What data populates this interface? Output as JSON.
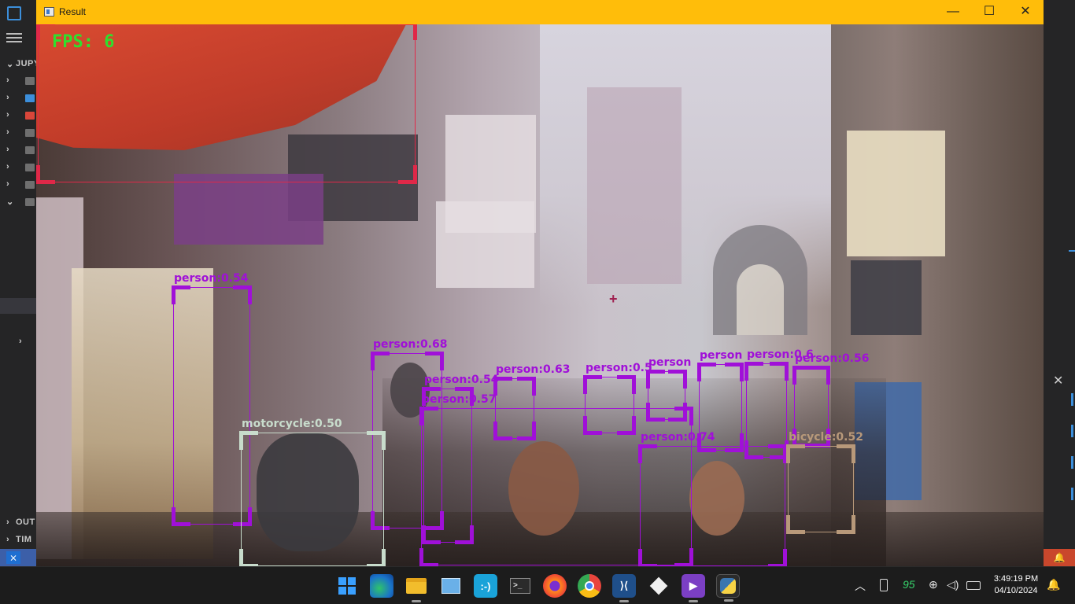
{
  "window": {
    "title": "Result",
    "minimize_glyph": "—",
    "maximize_glyph": "☐",
    "close_glyph": "✕"
  },
  "ide": {
    "explorer_label": "JUPY",
    "outline_label": "OUT",
    "timeline_label": "TIM",
    "rows": [
      {
        "chev": "›"
      },
      {
        "chev": "›"
      },
      {
        "chev": "›"
      },
      {
        "chev": "›"
      },
      {
        "chev": "›"
      },
      {
        "chev": "›"
      },
      {
        "chev": "›"
      },
      {
        "chev": "⌄"
      },
      {
        "chev": "⌄"
      },
      {
        "chev": "›"
      }
    ]
  },
  "overlay": {
    "fps": "FPS: 6",
    "cursor_glyph": "+"
  },
  "colors": {
    "person": "#a010d8",
    "motorcycle": "#c8dccc",
    "bicycle": "#b8997a",
    "unlabeled": "#e02848",
    "titlebar": "#ffbd0a"
  },
  "detections": [
    {
      "label": "",
      "color": "#e02848"
    },
    {
      "label": "person:0.54",
      "color": "#a010d8"
    },
    {
      "label": "person:0.68",
      "color": "#a010d8"
    },
    {
      "label": "person:0.54",
      "color": "#a010d8"
    },
    {
      "label": "person:0.57",
      "color": "#a010d8"
    },
    {
      "label": "person:0.63",
      "color": "#a010d8"
    },
    {
      "label": "person:0.5",
      "color": "#a010d8"
    },
    {
      "label": "person",
      "color": "#a010d8"
    },
    {
      "label": "person",
      "color": "#a010d8"
    },
    {
      "label": "person:0.6",
      "color": "#a010d8"
    },
    {
      "label": "person:0.56",
      "color": "#a010d8"
    },
    {
      "label": "person:0.74",
      "color": "#a010d8"
    },
    {
      "label": "motorcycle:0.50",
      "color": "#c8dccc"
    },
    {
      "label": "bicycle:0.52",
      "color": "#b8997a"
    }
  ],
  "taskbar": {
    "apps": [
      {
        "name": "windows-start-icon"
      },
      {
        "name": "edge-icon"
      },
      {
        "name": "file-explorer-icon"
      },
      {
        "name": "app-icon"
      },
      {
        "name": "feedback-icon"
      },
      {
        "name": "terminal-icon"
      },
      {
        "name": "firefox-icon"
      },
      {
        "name": "chrome-icon"
      },
      {
        "name": "vscode-icon"
      },
      {
        "name": "box-app-icon"
      },
      {
        "name": "visual-studio-icon"
      },
      {
        "name": "python-icon"
      }
    ],
    "battery_level": "95",
    "time": "3:49:19 PM",
    "date": "04/10/2024"
  }
}
